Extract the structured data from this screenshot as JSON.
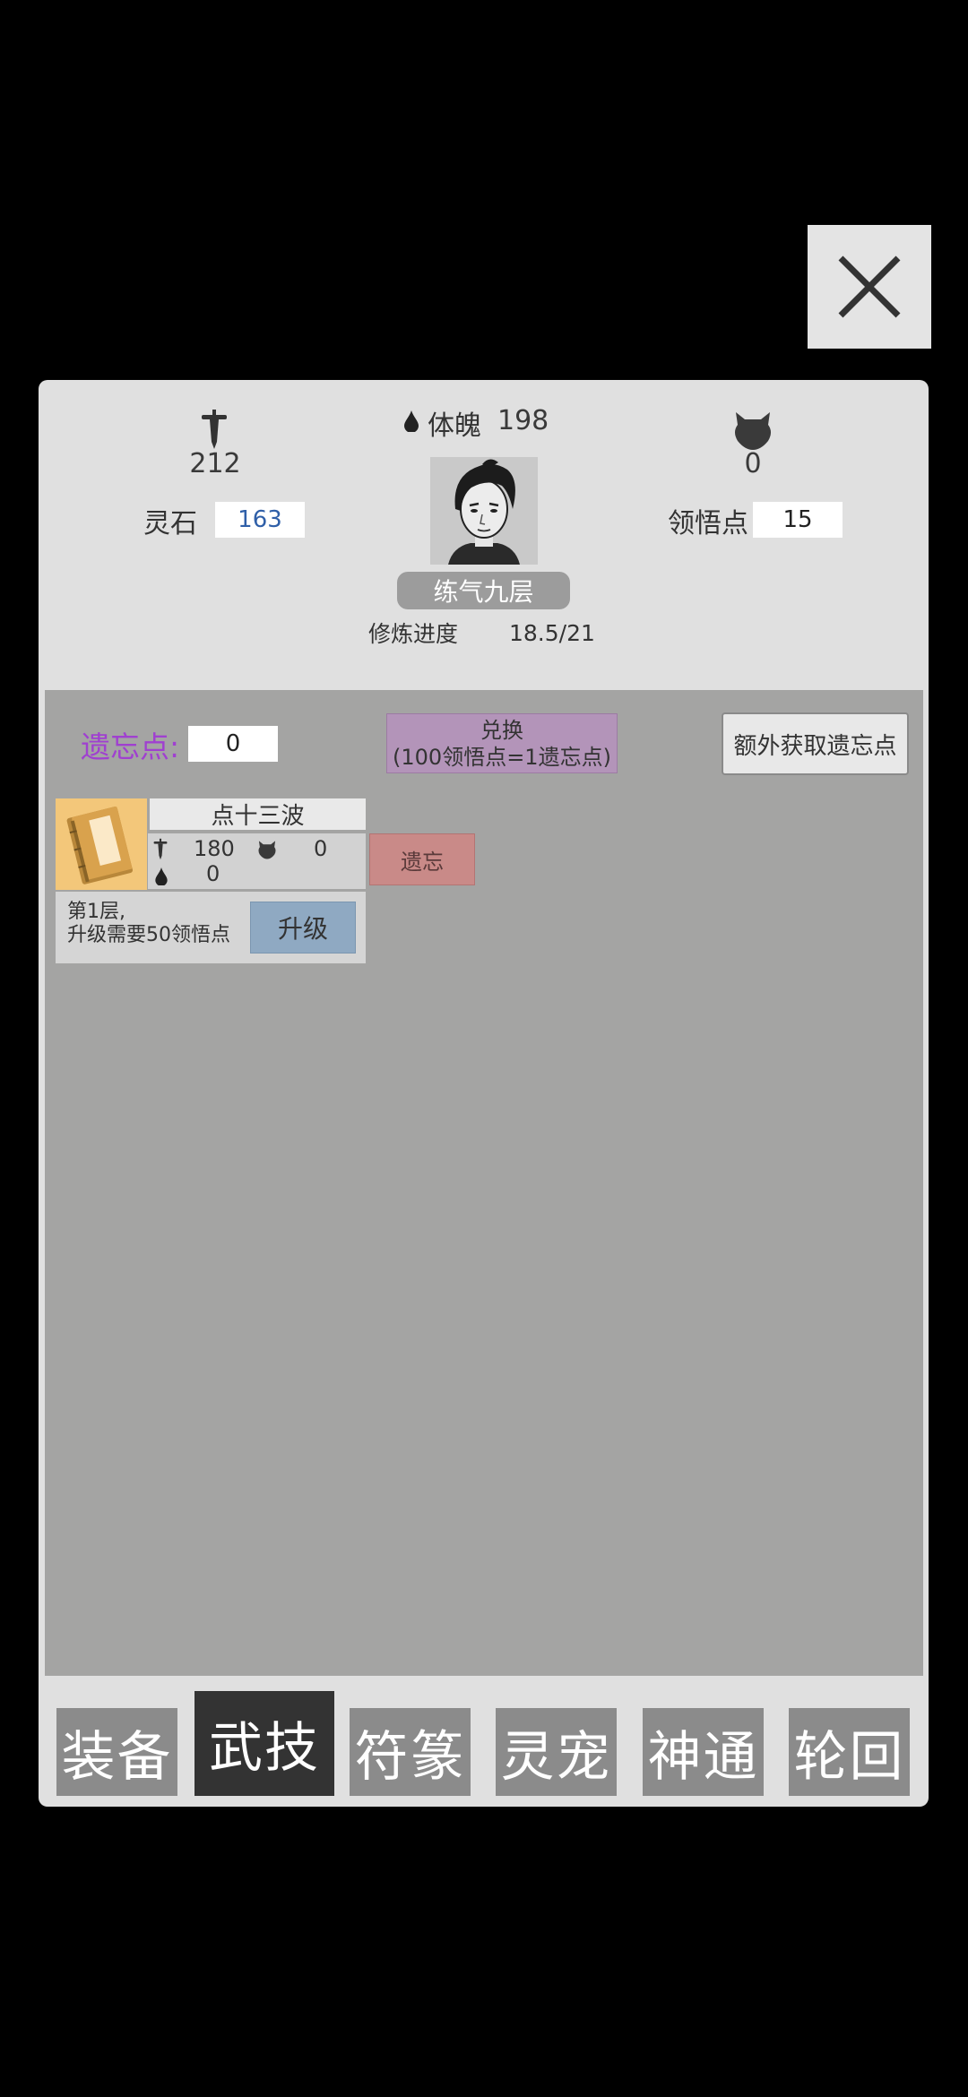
{
  "close_button": {
    "label": "X"
  },
  "stats": {
    "attack": {
      "icon": "sword-icon",
      "value": "212"
    },
    "physique": {
      "icon": "drop-icon",
      "label": "体魄",
      "value": "198"
    },
    "defense": {
      "icon": "beast-head-icon",
      "value": "0"
    },
    "spirit_stone": {
      "label": "灵石",
      "value": "163"
    },
    "insight_points": {
      "label": "领悟点",
      "value": "15"
    }
  },
  "character": {
    "realm": "练气九层",
    "progress_label": "修炼进度",
    "progress_value": "18.5/21",
    "progress_fraction": 0.881
  },
  "forget_points": {
    "label": "遗忘点:",
    "value": "0"
  },
  "exchange_button": {
    "line1": "兑换",
    "line2": "(100领悟点=1遗忘点)"
  },
  "extra_button": {
    "label": "额外获取遗忘点"
  },
  "skill": {
    "icon": "book-icon",
    "name": "点十三波",
    "attack": "180",
    "defense": "0",
    "physique": "0",
    "level_text_1": "第1层,",
    "level_text_2": "升级需要50领悟点",
    "upgrade_label": "升级",
    "forget_label": "遗忘"
  },
  "tabs": [
    {
      "label": "装备",
      "active": false
    },
    {
      "label": "武技",
      "active": true
    },
    {
      "label": "符篆",
      "active": false
    },
    {
      "label": "灵宠",
      "active": false
    },
    {
      "label": "神通",
      "active": false
    },
    {
      "label": "轮回",
      "active": false
    }
  ],
  "colors": {
    "accent_purple": "#a040d0",
    "value_blue": "#2f5fa8",
    "upgrade_blue": "#8fa9c2",
    "forget_red": "#c98a88",
    "book_gold": "#f3c77a"
  }
}
